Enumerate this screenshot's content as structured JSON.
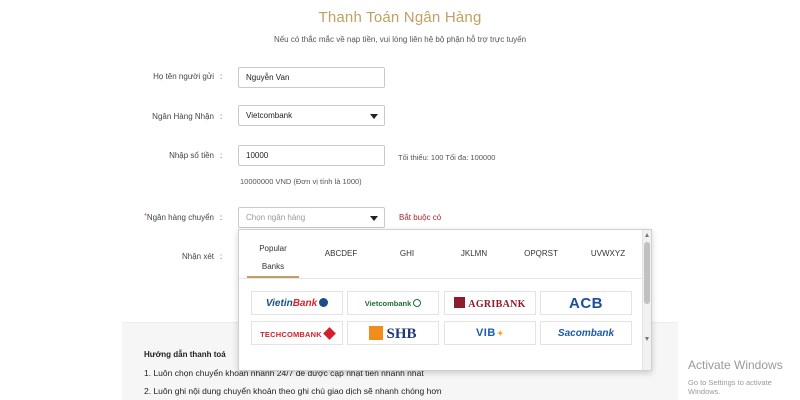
{
  "header": {
    "title": "Thanh Toán Ngân Hàng",
    "subtitle": "Nếu có thắc mắc về nạp tiền, vui lòng liên hệ bộ phận hỗ trợ trực tuyến"
  },
  "form": {
    "sender_name": {
      "label": "Họ tên người gửi",
      "colon": ":",
      "value": "Nguyễn Van"
    },
    "receiving_bank": {
      "label": "Ngân Hàng Nhận",
      "colon": ":",
      "value": "Vietcombank"
    },
    "amount": {
      "label": "Nhập số tiền",
      "colon": ":",
      "value": "10000",
      "limit_hint": "Tối thiểu: 100 Tối đa: 100000",
      "converted": "10000000 VND (Đơn vị tính là 1000)"
    },
    "transfer_bank": {
      "label": "Ngân hàng chuyển",
      "required_mark": "*",
      "colon": ":",
      "placeholder": "Chọn ngân hàng",
      "required_hint": "Bắt buộc có"
    },
    "note": {
      "label": "Nhận xét",
      "colon": ":"
    }
  },
  "dropdown": {
    "tabs": [
      {
        "line1": "Popular",
        "line2": "Banks"
      },
      {
        "label": "ABCDEF"
      },
      {
        "label": "GHI"
      },
      {
        "label": "JKLMN"
      },
      {
        "label": "OPQRST"
      },
      {
        "label": "UVWXYZ"
      }
    ],
    "banks": {
      "vietinbank": {
        "main": "Vietin",
        "accent": "Bank"
      },
      "vietcombank": "Vietcombank",
      "agribank": "AGRIBANK",
      "acb": "ACB",
      "techcombank": "TECHCOMBANK",
      "shb": "SHB",
      "vib": "VIB",
      "sacombank": "Sacombank"
    },
    "colors": {
      "vietinbank": "#1a4e8c",
      "vietcombank": "#1f6e39",
      "agribank": "#8b1d2c",
      "acb": "#1b4f9c",
      "techcombank": "#d4202c",
      "shb": "#1d3a7a",
      "vib": "#1c5ca9",
      "sacombank": "#1d5aa5"
    }
  },
  "guide": {
    "title": "Hướng dẫn thanh toá",
    "line1": "1. Luôn chọn chuyển khoản nhanh 24/7 để được cập nhật tiền nhanh nhất",
    "line2": "2. Luôn ghi nội dung chuyển khoản theo ghi chú giao dịch sẽ nhanh chóng hơn"
  },
  "watermark": {
    "title": "Activate Windows",
    "subtitle": "Go to Settings to activate Windows."
  },
  "theme": {
    "accent": "#c0a062",
    "required": "#a8262b"
  }
}
